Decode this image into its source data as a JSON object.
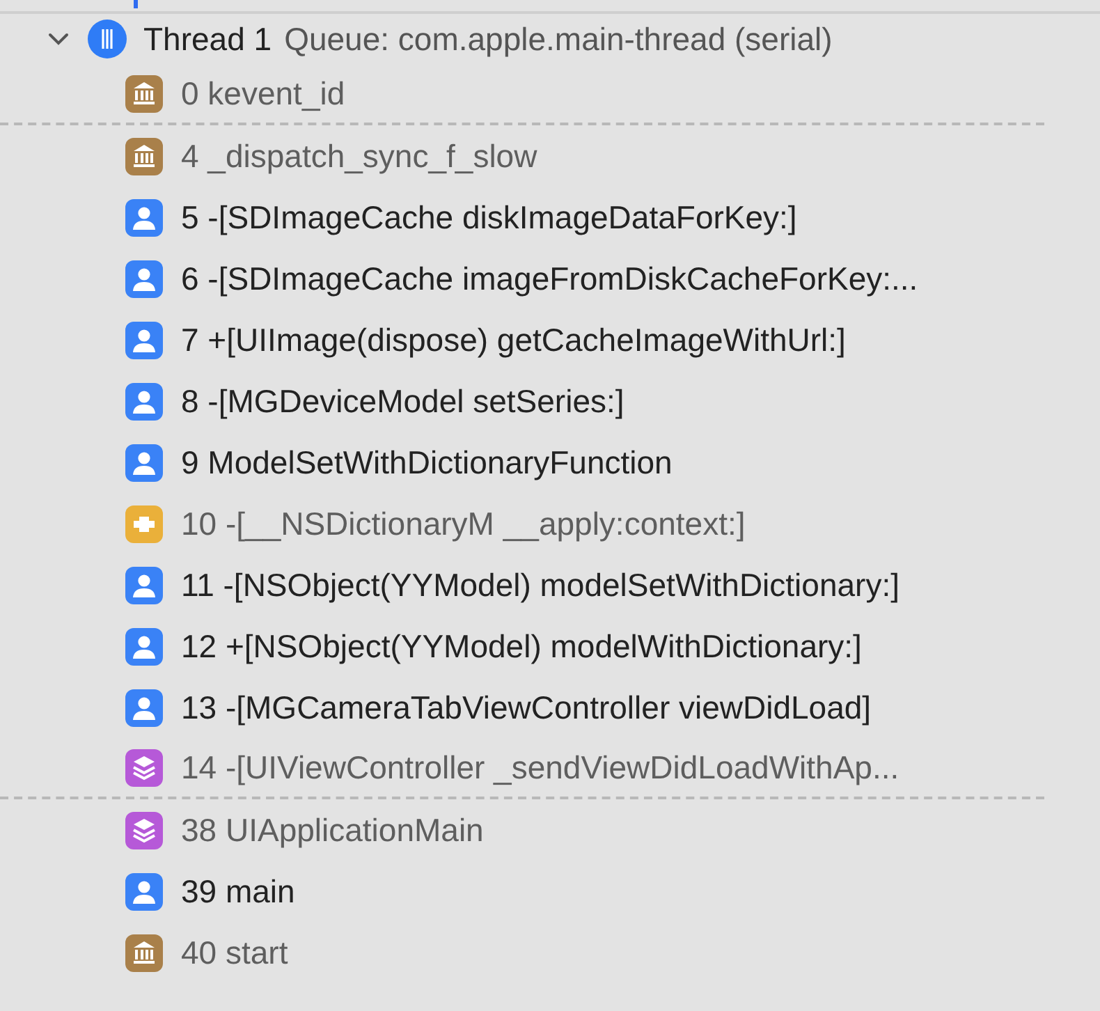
{
  "thread": {
    "expanded": true,
    "name": "Thread 1",
    "queue": "Queue: com.apple.main-thread (serial)",
    "frames": [
      {
        "kind": "library",
        "text": "0 kevent_id",
        "elided_after": true
      },
      {
        "kind": "library",
        "text": "4 _dispatch_sync_f_slow",
        "elided_after": false
      },
      {
        "kind": "user",
        "text": "5 -[SDImageCache diskImageDataForKey:]",
        "elided_after": false
      },
      {
        "kind": "user",
        "text": "6 -[SDImageCache imageFromDiskCacheForKey:...",
        "elided_after": false
      },
      {
        "kind": "user",
        "text": "7 +[UIImage(dispose) getCacheImageWithUrl:]",
        "elided_after": false
      },
      {
        "kind": "user",
        "text": "8 -[MGDeviceModel setSeries:]",
        "elided_after": false
      },
      {
        "kind": "user",
        "text": "9 ModelSetWithDictionaryFunction",
        "elided_after": false
      },
      {
        "kind": "foundation",
        "text": "10 -[__NSDictionaryM __apply:context:]",
        "elided_after": false
      },
      {
        "kind": "user",
        "text": "11 -[NSObject(YYModel) modelSetWithDictionary:]",
        "elided_after": false
      },
      {
        "kind": "user",
        "text": "12 +[NSObject(YYModel) modelWithDictionary:]",
        "elided_after": false
      },
      {
        "kind": "user",
        "text": "13 -[MGCameraTabViewController viewDidLoad]",
        "elided_after": false
      },
      {
        "kind": "framework",
        "text": "14 -[UIViewController _sendViewDidLoadWithAp...",
        "elided_after": true
      },
      {
        "kind": "framework",
        "text": "38 UIApplicationMain",
        "elided_after": false
      },
      {
        "kind": "user",
        "text": "39 main",
        "elided_after": false
      },
      {
        "kind": "library",
        "text": "40 start",
        "elided_after": false
      }
    ]
  }
}
